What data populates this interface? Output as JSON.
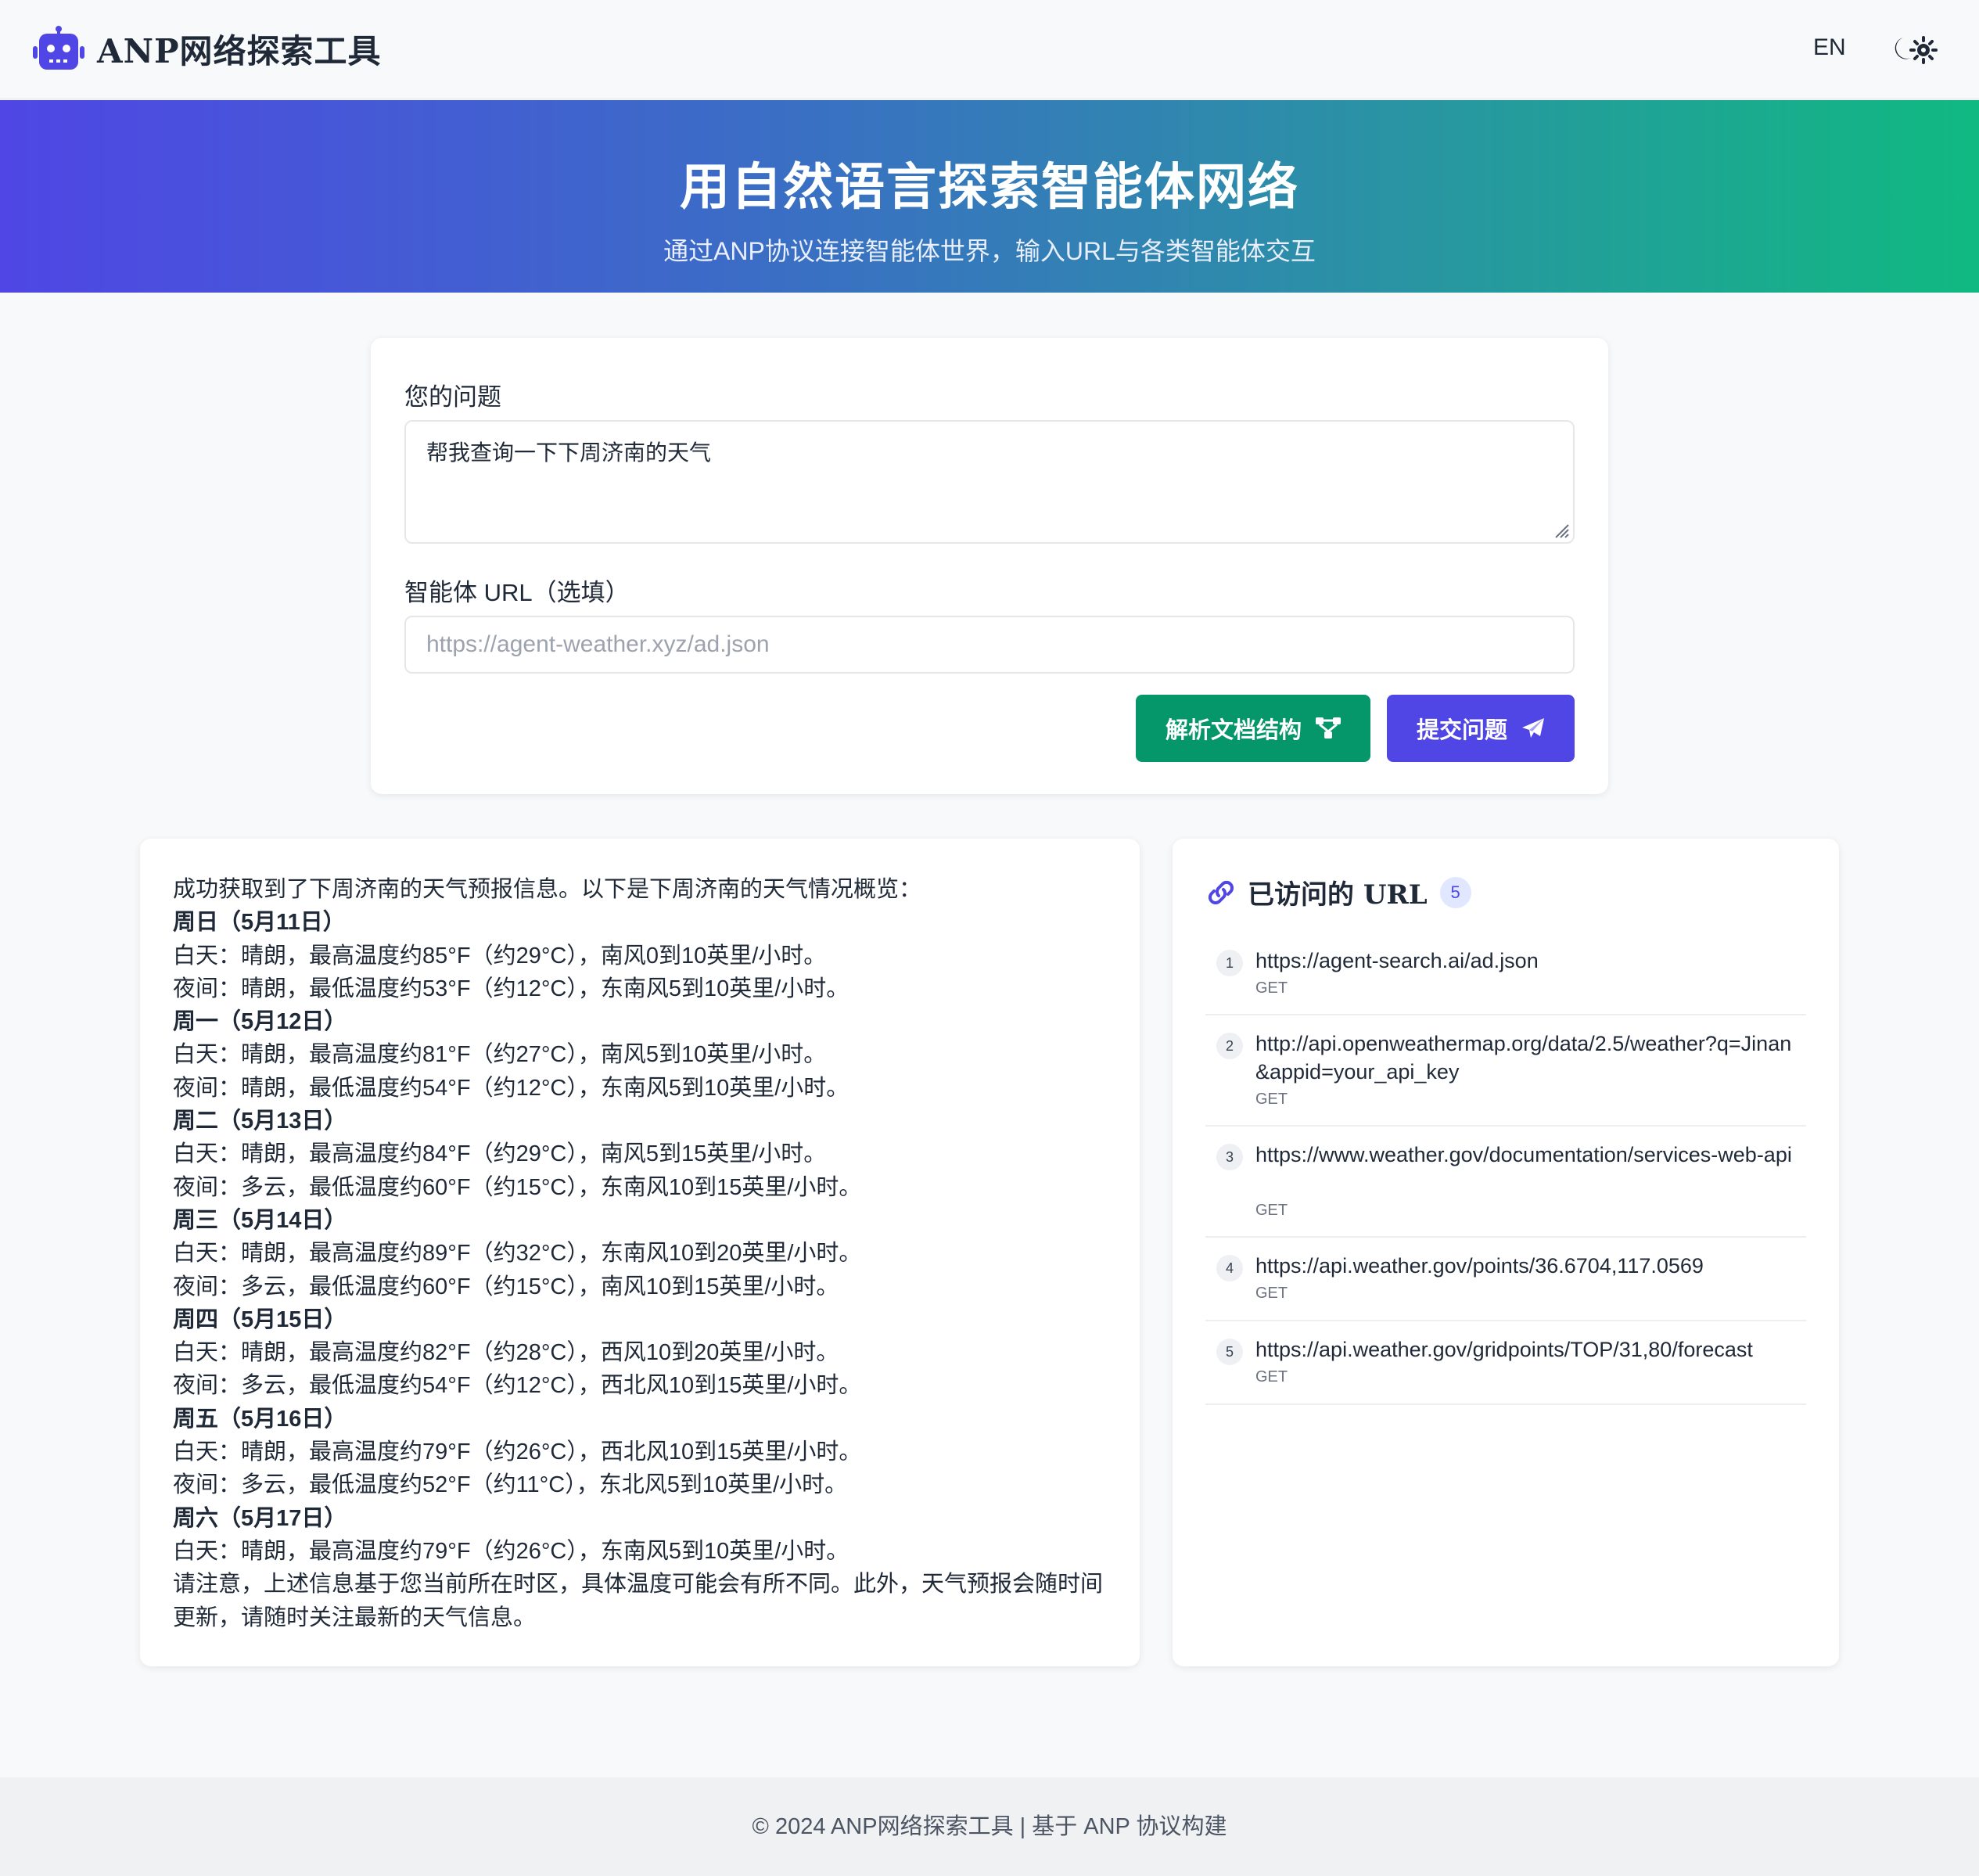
{
  "header": {
    "app_title": "ANP网络探索工具",
    "lang_toggle": "EN",
    "brand_icon": "robot-icon",
    "theme_icon": "moon-sun-icon"
  },
  "hero": {
    "title": "用自然语言探索智能体网络",
    "subtitle": "通过ANP协议连接智能体世界，输入URL与各类智能体交互"
  },
  "form": {
    "question_label": "您的问题",
    "question_value": "帮我查询一下下周济南的天气",
    "url_label": "智能体 URL（选填）",
    "url_placeholder": "https://agent-weather.xyz/ad.json",
    "parse_button": "解析文档结构",
    "submit_button": "提交问题"
  },
  "result": {
    "lines": [
      "成功获取到了下周济南的天气预报信息。以下是下周济南的天气情况概览：",
      "周日（5月11日）",
      "白天：晴朗，最高温度约85°F（约29°C），南风0到10英里/小时。",
      "夜间：晴朗，最低温度约53°F（约12°C），东南风5到10英里/小时。",
      "周一（5月12日）",
      "白天：晴朗，最高温度约81°F（约27°C），南风5到10英里/小时。",
      "夜间：晴朗，最低温度约54°F（约12°C），东南风5到10英里/小时。",
      "周二（5月13日）",
      "白天：晴朗，最高温度约84°F（约29°C），南风5到15英里/小时。",
      "夜间：多云，最低温度约60°F（约15°C），东南风10到15英里/小时。",
      "周三（5月14日）",
      "白天：晴朗，最高温度约89°F（约32°C），东南风10到20英里/小时。",
      "夜间：多云，最低温度约60°F（约15°C），南风10到15英里/小时。",
      "周四（5月15日）",
      "白天：晴朗，最高温度约82°F（约28°C），西风10到20英里/小时。",
      "夜间：多云，最低温度约54°F（约12°C），西北风10到15英里/小时。",
      "周五（5月16日）",
      "白天：晴朗，最高温度约79°F（约26°C），西北风10到15英里/小时。",
      "夜间：多云，最低温度约52°F（约11°C），东北风5到10英里/小时。",
      "周六（5月17日）",
      "白天：晴朗，最高温度约79°F（约26°C），东南风5到10英里/小时。",
      "请注意，上述信息基于您当前所在时区，具体温度可能会有所不同。此外，天气预报会随时间更新，请随时关注最新的天气信息。"
    ]
  },
  "visited": {
    "title": "已访问的 URL",
    "count": "5",
    "items": [
      {
        "num": "1",
        "url": "https://agent-search.ai/ad.json",
        "method": "GET"
      },
      {
        "num": "2",
        "url": "http://api.openweathermap.org/data/2.5/weather?q=Jinan&appid=your_api_key",
        "method": "GET"
      },
      {
        "num": "3",
        "url": "https://www.weather.gov/documentation/services-web-api",
        "method": "GET"
      },
      {
        "num": "4",
        "url": "https://api.weather.gov/points/36.6704,117.0569",
        "method": "GET"
      },
      {
        "num": "5",
        "url": "https://api.weather.gov/gridpoints/TOP/31,80/forecast",
        "method": "GET"
      }
    ]
  },
  "footer": {
    "text": "© 2024 ANP网络探索工具 | 基于 ANP 协议构建"
  },
  "colors": {
    "primary": "#4f46e5",
    "success": "#059669",
    "gradient_end": "#10b981"
  }
}
